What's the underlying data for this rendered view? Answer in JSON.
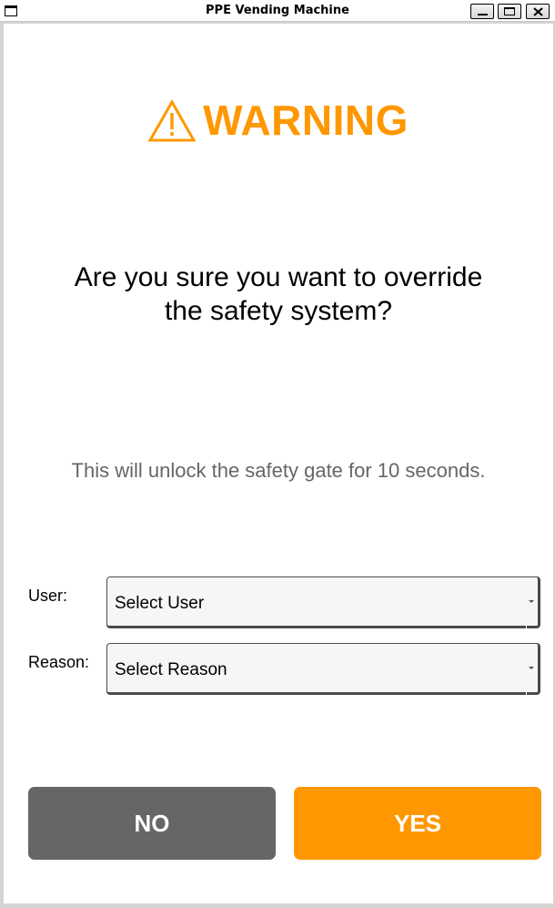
{
  "window": {
    "title": "PPE Vending Machine"
  },
  "dialog": {
    "warning_title": "WARNING",
    "question_line1": "Are you sure you want to override",
    "question_line2": "the safety system?",
    "info": "This will unlock the safety gate for 10 seconds.",
    "user_label": "User:",
    "user_selected": "Select User",
    "reason_label": "Reason:",
    "reason_selected": "Select Reason",
    "no_label": "NO",
    "yes_label": "YES"
  },
  "icons": {
    "warning": "warning-triangle-icon",
    "dropdown": "chevron-down-icon"
  },
  "colors": {
    "accent": "#ff9800",
    "no_button": "#666666",
    "info_text": "#666666"
  }
}
